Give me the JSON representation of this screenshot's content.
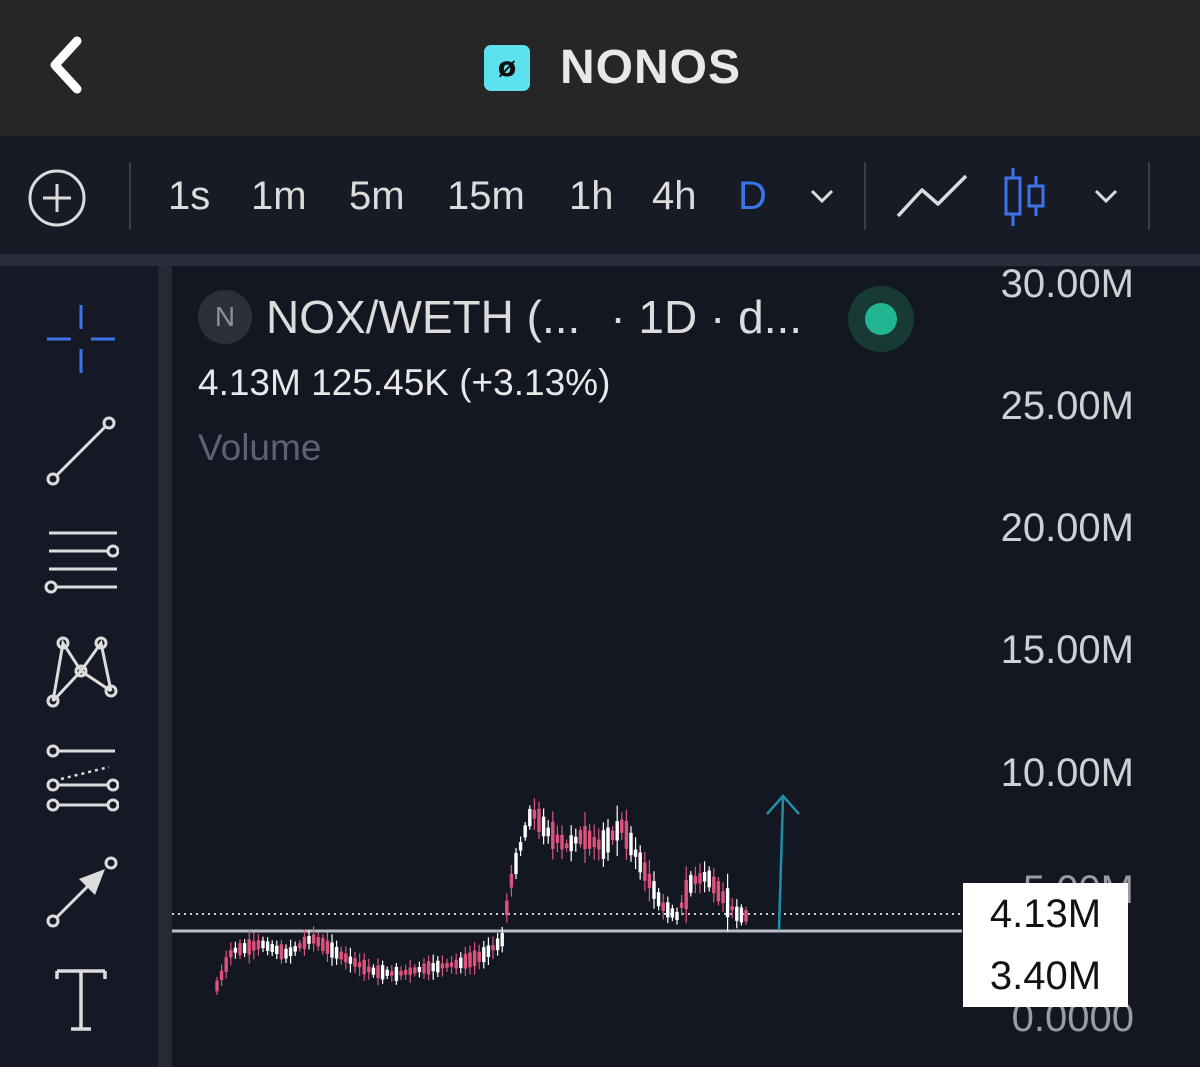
{
  "header": {
    "title": "NONOS",
    "logo_glyph": "ø",
    "logo_color": "#5ee1ef"
  },
  "toolbar": {
    "timeframes": [
      "1s",
      "1m",
      "5m",
      "15m",
      "1h",
      "4h",
      "D"
    ],
    "active_timeframe": "D",
    "accent": "#3b73e8"
  },
  "legend": {
    "badge": "N",
    "pair": "NOX/WETH (...",
    "interval": "· 1D · d...",
    "ohlc": "4.13M  125.45K (+3.13%)",
    "volume_label": "Volume"
  },
  "axis": {
    "labels": [
      "30.00M",
      "25.00M",
      "20.00M",
      "15.00M",
      "10.00M"
    ],
    "hidden_labels": [
      "5.00M",
      "0.0000"
    ]
  },
  "price_tags": {
    "current": "4.13M",
    "secondary": "3.40M"
  },
  "colors": {
    "up": "#ffffff",
    "down": "#e0527e",
    "arrow": "#1f8fa8"
  }
}
